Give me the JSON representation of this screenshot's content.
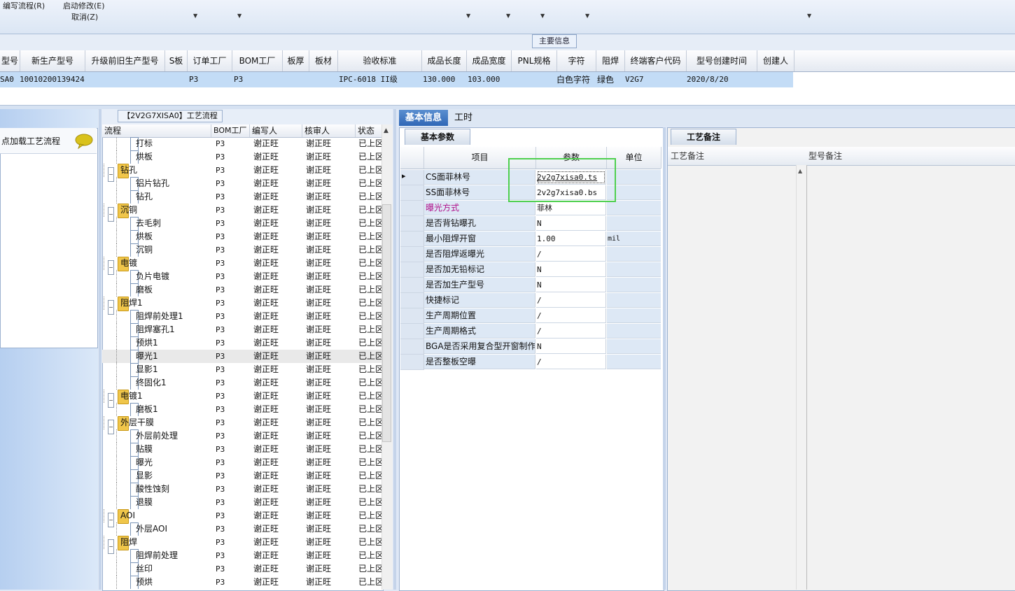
{
  "toolbar": {
    "edit_flow": "编写流程(R)",
    "start_modify": "启动修改(E)",
    "cancel": "取消(Z)"
  },
  "main_info_tab": "主要信息",
  "grid": {
    "columns": [
      "型号",
      "新生产型号",
      "升级前旧生产型号",
      "S板",
      "订单工厂",
      "BOM工厂",
      "板厚",
      "板材",
      "验收标准",
      "成品长度",
      "成品宽度",
      "PNL规格",
      "字符",
      "阻焊",
      "终端客户代码",
      "型号创建时间",
      "创建人"
    ],
    "row": {
      "model": "SA0",
      "new_model": "10010200139424",
      "old_model": "",
      "s_board": "",
      "order_factory": "P3",
      "bom_factory": "P3",
      "thickness": "",
      "material": "",
      "standard": "IPC-6018 II级",
      "length": "130.000",
      "width": "103.000",
      "pnl": "",
      "char": "白色字符",
      "mask": "绿色",
      "customer": "V2G7",
      "created": "2020/8/20",
      "creator": ""
    }
  },
  "left_panel": {
    "load_label": "点加载工艺流程",
    "chat_icon": "speech-bubble-icon"
  },
  "flow": {
    "title": "【2V2G7XISA0】工艺流程",
    "columns": [
      "流程",
      "BOM工厂",
      "编写人",
      "核审人",
      "状态"
    ],
    "rows": [
      {
        "level": 2,
        "name": "打标",
        "bom": "P3",
        "writer": "谢正旺",
        "reviewer": "谢正旺",
        "status": "已上区"
      },
      {
        "level": 2,
        "name": "烘板",
        "bom": "P3",
        "writer": "谢正旺",
        "reviewer": "谢正旺",
        "status": "已上区"
      },
      {
        "level": 1,
        "name": "钻孔",
        "bom": "P3",
        "writer": "谢正旺",
        "reviewer": "谢正旺",
        "status": "已上区"
      },
      {
        "level": 2,
        "name": "铝片钻孔",
        "bom": "P3",
        "writer": "谢正旺",
        "reviewer": "谢正旺",
        "status": "已上区"
      },
      {
        "level": 2,
        "name": "钻孔",
        "bom": "P3",
        "writer": "谢正旺",
        "reviewer": "谢正旺",
        "status": "已上区"
      },
      {
        "level": 1,
        "name": "沉铜",
        "bom": "P3",
        "writer": "谢正旺",
        "reviewer": "谢正旺",
        "status": "已上区"
      },
      {
        "level": 2,
        "name": "去毛刺",
        "bom": "P3",
        "writer": "谢正旺",
        "reviewer": "谢正旺",
        "status": "已上区"
      },
      {
        "level": 2,
        "name": "烘板",
        "bom": "P3",
        "writer": "谢正旺",
        "reviewer": "谢正旺",
        "status": "已上区"
      },
      {
        "level": 2,
        "name": "沉铜",
        "bom": "P3",
        "writer": "谢正旺",
        "reviewer": "谢正旺",
        "status": "已上区"
      },
      {
        "level": 1,
        "name": "电镀",
        "bom": "P3",
        "writer": "谢正旺",
        "reviewer": "谢正旺",
        "status": "已上区"
      },
      {
        "level": 2,
        "name": "负片电镀",
        "bom": "P3",
        "writer": "谢正旺",
        "reviewer": "谢正旺",
        "status": "已上区"
      },
      {
        "level": 2,
        "name": "磨板",
        "bom": "P3",
        "writer": "谢正旺",
        "reviewer": "谢正旺",
        "status": "已上区"
      },
      {
        "level": 1,
        "name": "阻焊1",
        "bom": "P3",
        "writer": "谢正旺",
        "reviewer": "谢正旺",
        "status": "已上区"
      },
      {
        "level": 2,
        "name": "阻焊前处理1",
        "bom": "P3",
        "writer": "谢正旺",
        "reviewer": "谢正旺",
        "status": "已上区"
      },
      {
        "level": 2,
        "name": "阻焊塞孔1",
        "bom": "P3",
        "writer": "谢正旺",
        "reviewer": "谢正旺",
        "status": "已上区"
      },
      {
        "level": 2,
        "name": "预烘1",
        "bom": "P3",
        "writer": "谢正旺",
        "reviewer": "谢正旺",
        "status": "已上区"
      },
      {
        "level": 2,
        "name": "曝光1",
        "bom": "P3",
        "writer": "谢正旺",
        "reviewer": "谢正旺",
        "status": "已上区",
        "selected": true
      },
      {
        "level": 2,
        "name": "显影1",
        "bom": "P3",
        "writer": "谢正旺",
        "reviewer": "谢正旺",
        "status": "已上区"
      },
      {
        "level": 2,
        "name": "终固化1",
        "bom": "P3",
        "writer": "谢正旺",
        "reviewer": "谢正旺",
        "status": "已上区"
      },
      {
        "level": 1,
        "name": "电镀1",
        "bom": "P3",
        "writer": "谢正旺",
        "reviewer": "谢正旺",
        "status": "已上区"
      },
      {
        "level": 2,
        "name": "磨板1",
        "bom": "P3",
        "writer": "谢正旺",
        "reviewer": "谢正旺",
        "status": "已上区"
      },
      {
        "level": 1,
        "name": "外层干膜",
        "bom": "P3",
        "writer": "谢正旺",
        "reviewer": "谢正旺",
        "status": "已上区"
      },
      {
        "level": 2,
        "name": "外层前处理",
        "bom": "P3",
        "writer": "谢正旺",
        "reviewer": "谢正旺",
        "status": "已上区"
      },
      {
        "level": 2,
        "name": "贴膜",
        "bom": "P3",
        "writer": "谢正旺",
        "reviewer": "谢正旺",
        "status": "已上区"
      },
      {
        "level": 2,
        "name": "曝光",
        "bom": "P3",
        "writer": "谢正旺",
        "reviewer": "谢正旺",
        "status": "已上区"
      },
      {
        "level": 2,
        "name": "显影",
        "bom": "P3",
        "writer": "谢正旺",
        "reviewer": "谢正旺",
        "status": "已上区"
      },
      {
        "level": 2,
        "name": "酸性蚀刻",
        "bom": "P3",
        "writer": "谢正旺",
        "reviewer": "谢正旺",
        "status": "已上区"
      },
      {
        "level": 2,
        "name": "退膜",
        "bom": "P3",
        "writer": "谢正旺",
        "reviewer": "谢正旺",
        "status": "已上区"
      },
      {
        "level": 1,
        "name": "AOI",
        "bom": "P3",
        "writer": "谢正旺",
        "reviewer": "谢正旺",
        "status": "已上区"
      },
      {
        "level": 2,
        "name": "外层AOI",
        "bom": "P3",
        "writer": "谢正旺",
        "reviewer": "谢正旺",
        "status": "已上区"
      },
      {
        "level": 1,
        "name": "阻焊",
        "bom": "P3",
        "writer": "谢正旺",
        "reviewer": "谢正旺",
        "status": "已上区"
      },
      {
        "level": 2,
        "name": "阻焊前处理",
        "bom": "P3",
        "writer": "谢正旺",
        "reviewer": "谢正旺",
        "status": "已上区"
      },
      {
        "level": 2,
        "name": "丝印",
        "bom": "P3",
        "writer": "谢正旺",
        "reviewer": "谢正旺",
        "status": "已上区"
      },
      {
        "level": 2,
        "name": "预烘",
        "bom": "P3",
        "writer": "谢正旺",
        "reviewer": "谢正旺",
        "status": "已上区"
      }
    ]
  },
  "tabs": {
    "basic": "基本信息",
    "time": "工时"
  },
  "params": {
    "tab": "基本参数",
    "columns": [
      "项目",
      "参数",
      "单位"
    ],
    "rows": [
      {
        "item": "CS面菲林号",
        "value": "2v2g7xisa0.ts",
        "unit": "",
        "current": true
      },
      {
        "item": "SS面菲林号",
        "value": "2v2g7xisa0.bs",
        "unit": ""
      },
      {
        "item": "曝光方式",
        "value": "菲林",
        "unit": "",
        "magenta": true
      },
      {
        "item": "是否背钻曝孔",
        "value": "N",
        "unit": ""
      },
      {
        "item": "最小阻焊开窗",
        "value": "1.00",
        "unit": "mil"
      },
      {
        "item": "是否阻焊返曝光",
        "value": "/",
        "unit": ""
      },
      {
        "item": "是否加无铅标记",
        "value": "N",
        "unit": ""
      },
      {
        "item": "是否加生产型号",
        "value": "N",
        "unit": ""
      },
      {
        "item": "快捷标记",
        "value": "/",
        "unit": ""
      },
      {
        "item": "生产周期位置",
        "value": "/",
        "unit": ""
      },
      {
        "item": "生产周期格式",
        "value": "/",
        "unit": ""
      },
      {
        "item": "BGA是否采用复合型开窗制作",
        "value": "N",
        "unit": ""
      },
      {
        "item": "是否整板空曝",
        "value": "/",
        "unit": ""
      }
    ]
  },
  "remarks": {
    "tab": "工艺备注",
    "process_remark": "工艺备注",
    "model_remark": "型号备注"
  }
}
